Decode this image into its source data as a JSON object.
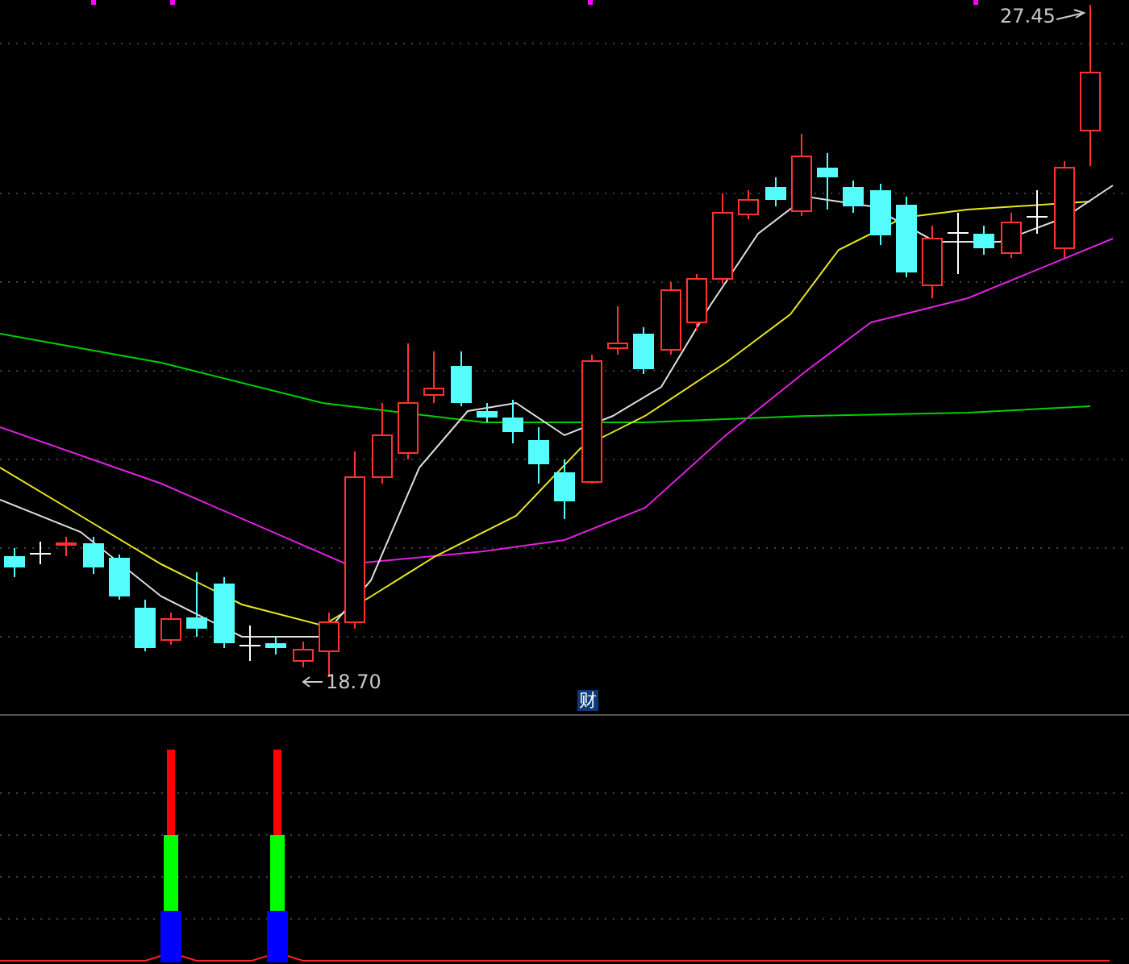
{
  "price_chart": {
    "high_label": "27.45",
    "low_label": "18.70",
    "marker_badge": "财"
  }
}
